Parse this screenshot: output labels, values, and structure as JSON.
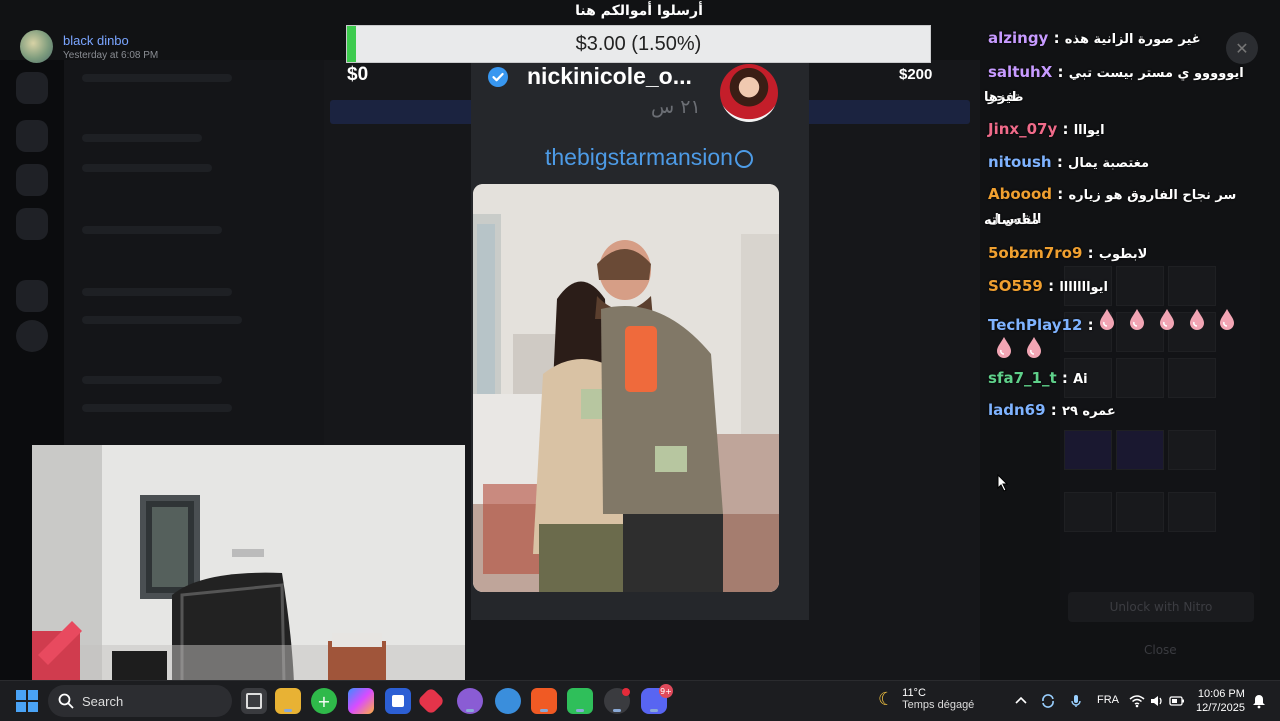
{
  "user": {
    "name": "black dinbo",
    "timestamp": "Yesterday at 6:08 PM"
  },
  "donation": {
    "title": "أرسلوا أموالكم هنا",
    "amount_text": "$3.00 (1.50%)",
    "progress_fraction": 0.015,
    "goal_min": "$0",
    "goal_max": "$200",
    "fill_color": "#3ecb4f"
  },
  "story": {
    "username": "nickinicole_o...",
    "time": "٢١ س",
    "link": "thebigstarmansion"
  },
  "chat": {
    "messages": [
      {
        "user": "alzingy",
        "color": "#c79bff",
        "text": "غير صورة الزانية هذه"
      },
      {
        "user": "saltuhX",
        "color": "#c79bff",
        "text": "ايووووو ي مستر بيست تبي تفجر",
        "wrap": "طيزها"
      },
      {
        "user": "Jinx_07y",
        "color": "#f06b8a",
        "text": "ايوااا"
      },
      {
        "user": "nitoush",
        "color": "#7fb3ff",
        "text": "مغتصبة يمال"
      },
      {
        "user": "Aboood",
        "color": "#f0a030",
        "text": "سر نجاح الفاروق هو زياره الناس ل",
        "wrap": "مقدساته"
      },
      {
        "user": "5obzm7ro9",
        "color": "#f0a030",
        "text": "لابطوب"
      },
      {
        "user": "SO559",
        "color": "#f0a030",
        "text": "ايوااااااا"
      },
      {
        "user": "TechPlay12",
        "color": "#7fb3ff",
        "text": ""
      },
      {
        "user": "sfa7_1_t",
        "color": "#5fd08a",
        "text": "Ai"
      },
      {
        "user": "ladn69",
        "color": "#7fb3ff",
        "text": "عمره ٢٩"
      }
    ]
  },
  "dim_ui": {
    "unlock_label": "Unlock with Nitro",
    "close_label": "Close"
  },
  "taskbar": {
    "search_label": "Search",
    "weather_temp": "11°C",
    "weather_desc": "Temps dégagé",
    "language": "FRA",
    "time": "10:06 PM",
    "date": "12/7/2025",
    "discord_badge": "9+"
  }
}
